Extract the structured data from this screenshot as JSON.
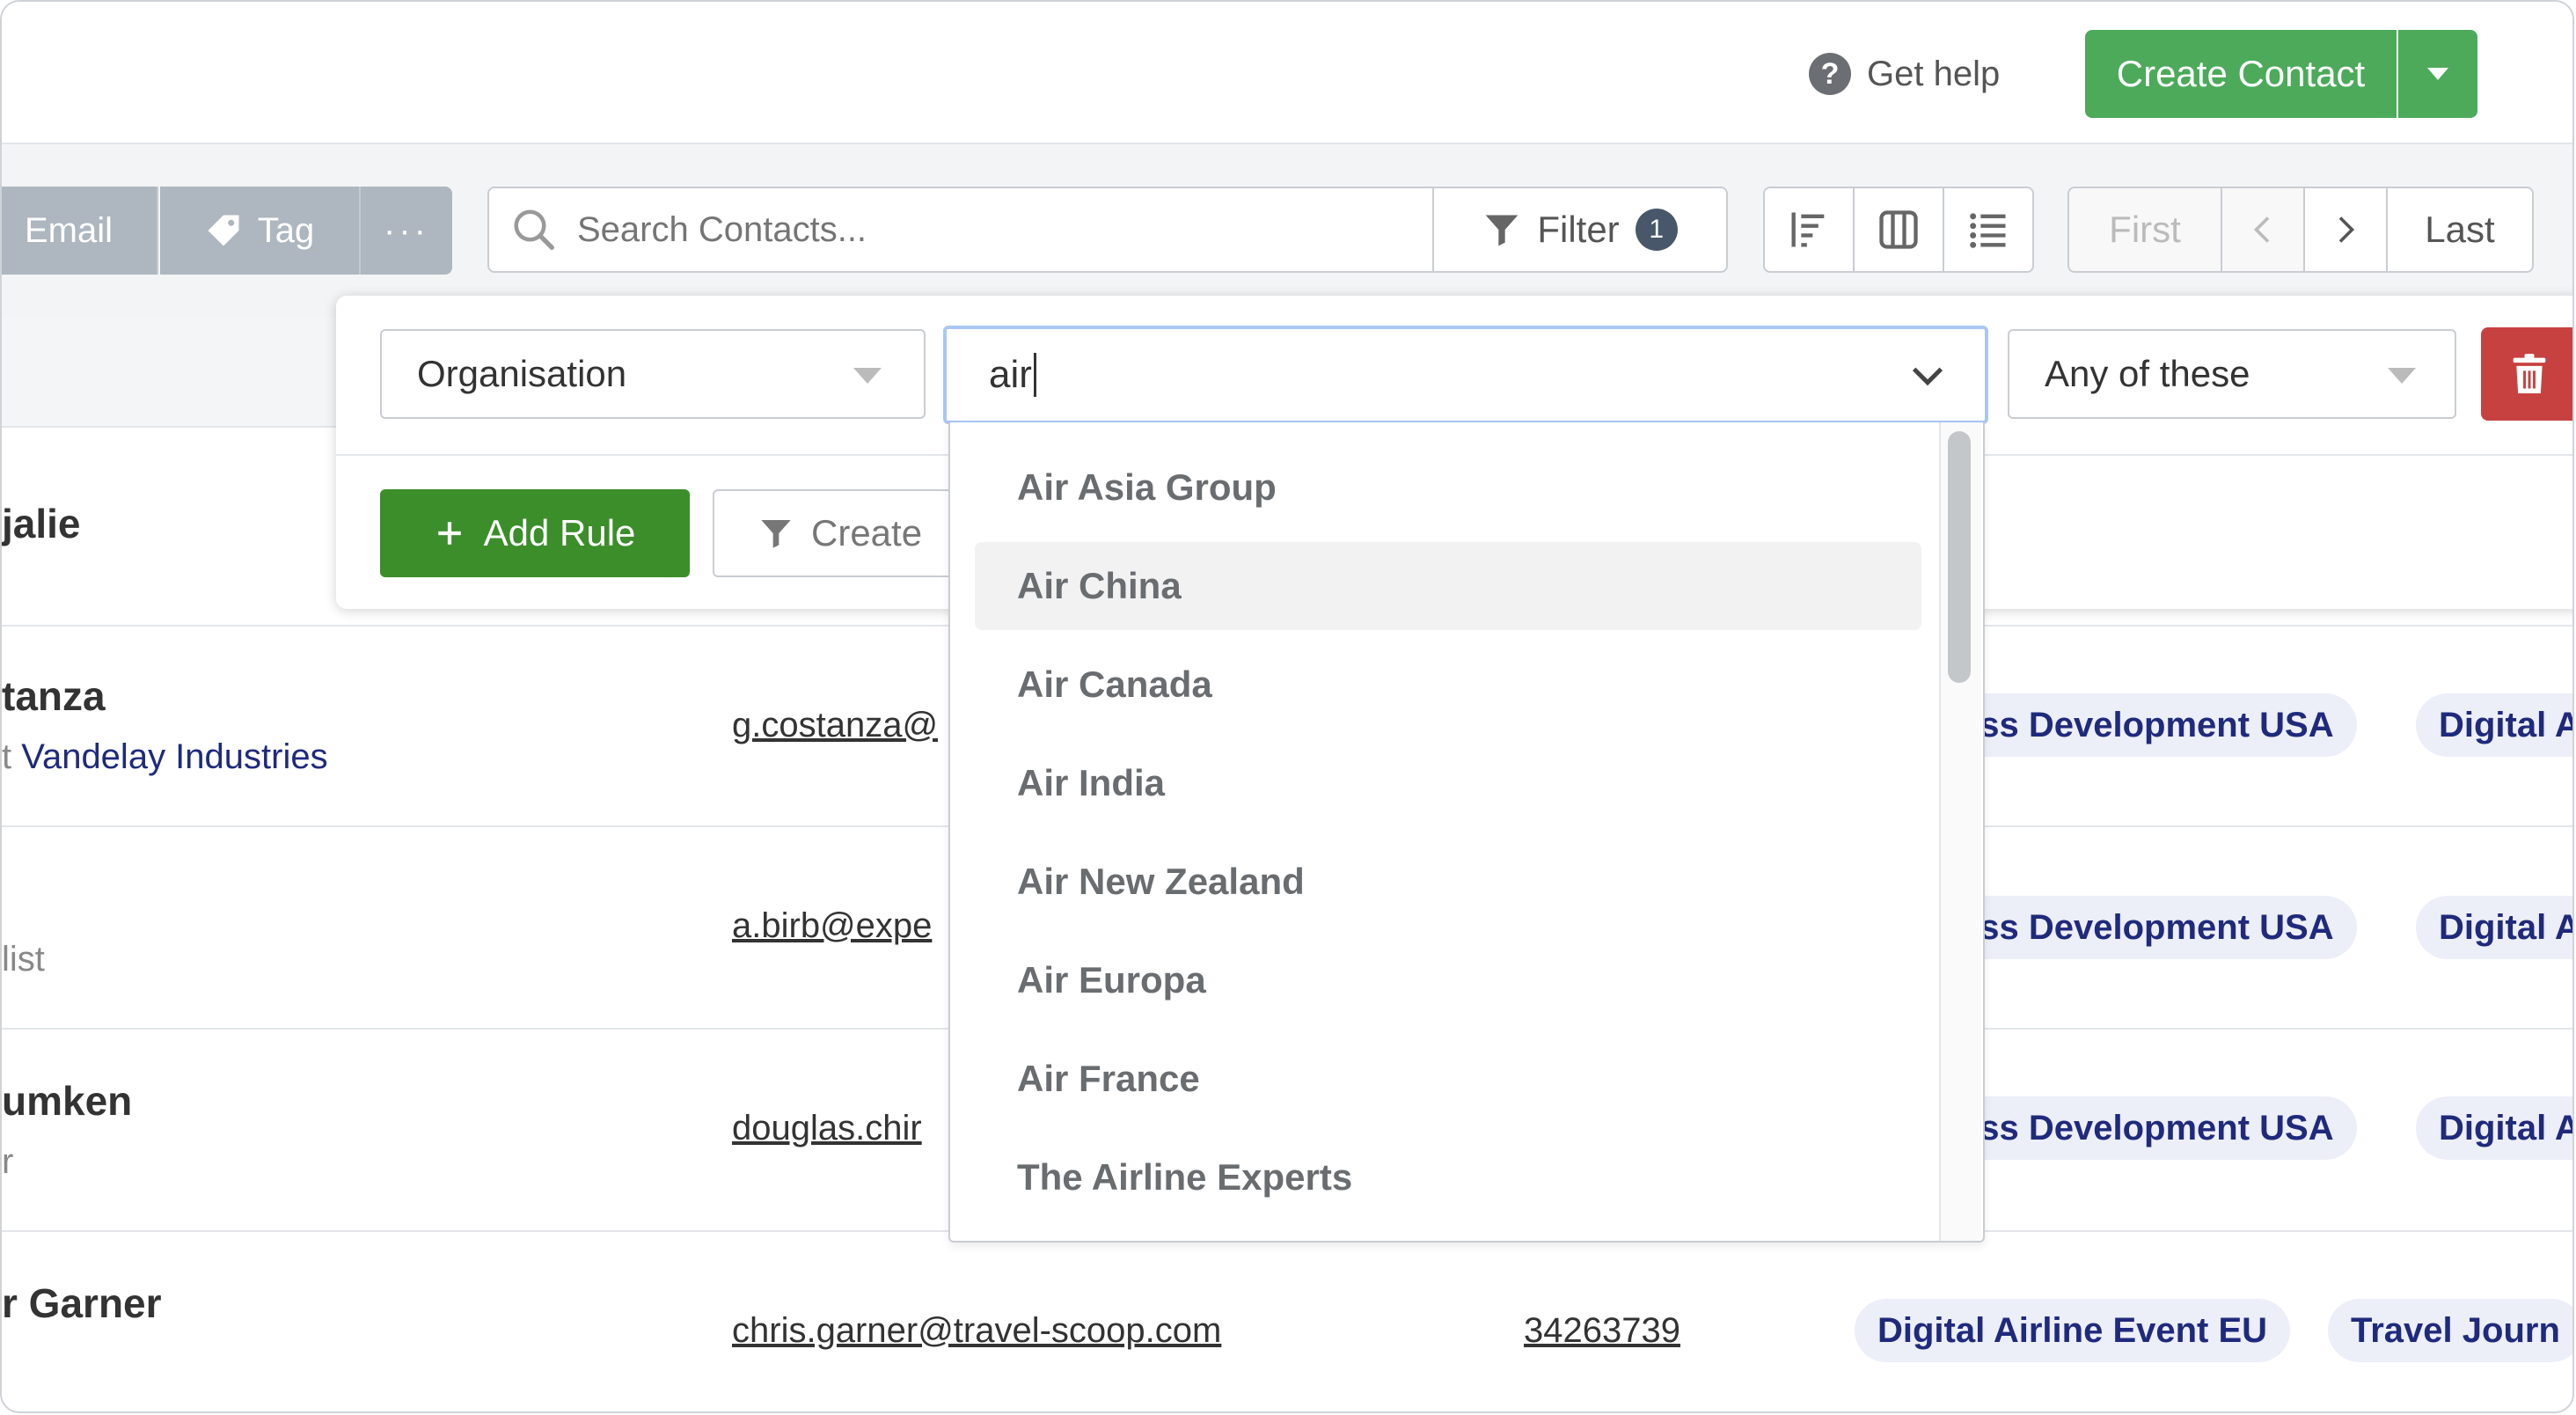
{
  "header": {
    "help_label": "Get help",
    "create_label": "Create Contact"
  },
  "toolbar": {
    "email_label": "Email",
    "tag_label": "Tag",
    "more_label": "···",
    "search_placeholder": "Search Contacts...",
    "filter_label": "Filter",
    "filter_count": "1",
    "pagination": {
      "first": "First",
      "last": "Last"
    }
  },
  "filter_rule": {
    "field": "Organisation",
    "value": "air",
    "match": "Any of these",
    "add_rule_label": "Add Rule",
    "create_filter_label": "Create",
    "options": [
      "Air Asia Group",
      "Air China",
      "Air Canada",
      "Air India",
      "Air New Zealand",
      "Air Europa",
      "Air France",
      "The Airline Experts"
    ],
    "highlighted_index": 1
  },
  "contacts": [
    {
      "name": "jalie"
    },
    {
      "name": "tanza",
      "sub_prefix": "t ",
      "org": "Vandelay Industries",
      "email": "g.costanza@",
      "tags": [
        "ess Development USA",
        "Digital A"
      ]
    },
    {
      "name": "",
      "sub": "list",
      "email": "a.birb@expe",
      "tags": [
        "ess Development USA",
        "Digital A"
      ]
    },
    {
      "name": "umken",
      "sub": "r",
      "email": "douglas.chir",
      "tags": [
        "ess Development USA",
        "Digital A"
      ]
    },
    {
      "name": "r Garner",
      "email": "chris.garner@travel-scoop.com",
      "phone": "34263739",
      "tags": [
        "Digital Airline Event EU",
        "Travel Journ"
      ]
    }
  ],
  "colors": {
    "primary_green": "#4caa5a",
    "add_rule_green": "#3b8e2a",
    "danger_red": "#c84141",
    "tag_text": "#1f2a7c",
    "focus_blue": "#a9c8f2"
  }
}
